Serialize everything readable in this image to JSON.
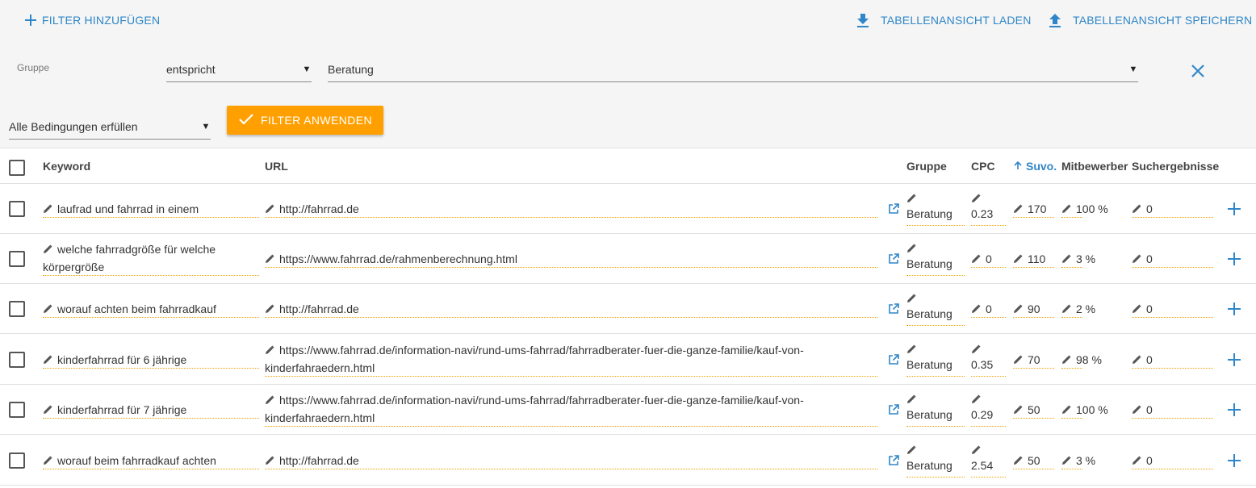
{
  "toolbar": {
    "add_filter": "FILTER HINZUFÜGEN",
    "load_view": "TABELLENANSICHT LADEN",
    "save_view": "TABELLENANSICHT SPEICHERN"
  },
  "filter": {
    "field_label": "Gruppe",
    "operator": "entspricht",
    "value": "Beratung",
    "condition_mode": "Alle Bedingungen erfüllen",
    "apply_label": "FILTER ANWENDEN"
  },
  "table": {
    "headers": {
      "keyword": "Keyword",
      "url": "URL",
      "gruppe": "Gruppe",
      "cpc": "CPC",
      "suvo": "Suvo.",
      "mitbewerber": "Mitbewerber",
      "suchergebnisse": "Suchergebnisse"
    },
    "rows": [
      {
        "keyword": "laufrad und fahrrad in einem",
        "url": "http://fahrrad.de",
        "gruppe": "Beratung",
        "cpc": "0.23",
        "suvo": "170",
        "mitbewerber": "100 %",
        "suchergebnisse": "0"
      },
      {
        "keyword": "welche fahrradgröße für welche körpergröße",
        "url": "https://www.fahrrad.de/rahmenberechnung.html",
        "gruppe": "Beratung",
        "cpc": "0",
        "suvo": "110",
        "mitbewerber": "3 %",
        "suchergebnisse": "0"
      },
      {
        "keyword": "worauf achten beim fahrradkauf",
        "url": "http://fahrrad.de",
        "gruppe": "Beratung",
        "cpc": "0",
        "suvo": "90",
        "mitbewerber": "2 %",
        "suchergebnisse": "0"
      },
      {
        "keyword": "kinderfahrrad für 6 jährige",
        "url": "https://www.fahrrad.de/information-navi/rund-ums-fahrrad/fahrradberater-fuer-die-ganze-familie/kauf-von-kinderfahraedern.html",
        "gruppe": "Beratung",
        "cpc": "0.35",
        "suvo": "70",
        "mitbewerber": "98 %",
        "suchergebnisse": "0"
      },
      {
        "keyword": "kinderfahrrad für 7 jährige",
        "url": "https://www.fahrrad.de/information-navi/rund-ums-fahrrad/fahrradberater-fuer-die-ganze-familie/kauf-von-kinderfahraedern.html",
        "gruppe": "Beratung",
        "cpc": "0.29",
        "suvo": "50",
        "mitbewerber": "100 %",
        "suchergebnisse": "0"
      },
      {
        "keyword": "worauf beim fahrradkauf achten",
        "url": "http://fahrrad.de",
        "gruppe": "Beratung",
        "cpc": "2.54",
        "suvo": "50",
        "mitbewerber": "3 %",
        "suchergebnisse": "0"
      }
    ]
  },
  "icons": {
    "add": "plus-icon",
    "download": "download-icon",
    "upload": "upload-icon",
    "close": "close-icon",
    "check": "check-icon",
    "edit": "pencil-icon",
    "external": "external-link-icon",
    "sort": "arrow-up-icon"
  },
  "colors": {
    "accent": "#2f86c8",
    "primary_button": "#ffa000",
    "edit_underline": "#f0a000"
  }
}
